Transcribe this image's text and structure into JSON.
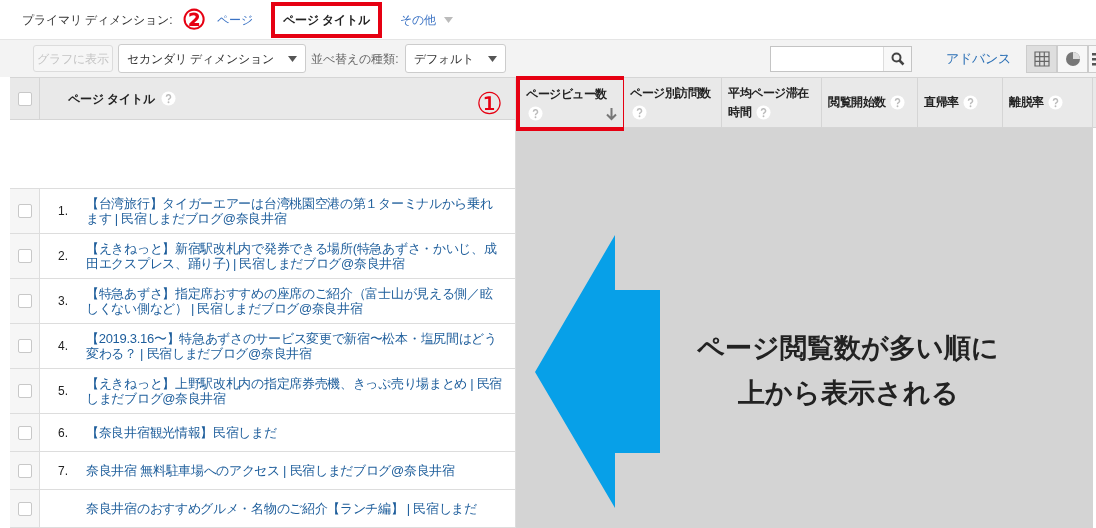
{
  "primary_dimension": {
    "label": "プライマリ ディメンション:",
    "options": [
      {
        "label": "ページ",
        "kind": "link",
        "selected": false,
        "highlighted": false
      },
      {
        "label": "ページ タイトル",
        "kind": "link",
        "selected": true,
        "highlighted": true
      },
      {
        "label": "その他",
        "kind": "menu",
        "selected": false,
        "highlighted": false
      }
    ]
  },
  "toolbar": {
    "chart_button": {
      "label": "グラフに表示",
      "disabled": true
    },
    "secondary_dimension": "セカンダリ ディメンション",
    "sort_label": "並べ替えの種類:",
    "sort_value": "デフォルト",
    "advanced_link": "アドバンス",
    "views": [
      {
        "kind": "table",
        "selected": true
      },
      {
        "kind": "pie",
        "selected": false
      },
      {
        "kind": "list",
        "selected": false
      }
    ]
  },
  "table": {
    "header_checkbox": {
      "checked": false
    },
    "columns": [
      {
        "label": "ページ タイトル",
        "sorted": false,
        "highlighted": false
      },
      {
        "label": "ページビュー数",
        "sorted": true,
        "highlighted": true
      },
      {
        "label": "ページ別訪問数",
        "sorted": false,
        "highlighted": false
      },
      {
        "label": "平均ページ滞在時間",
        "sorted": false,
        "highlighted": false
      },
      {
        "label": "閲覧開始数",
        "sorted": false,
        "highlighted": false
      },
      {
        "label": "直帰率",
        "sorted": false,
        "highlighted": false
      },
      {
        "label": "離脱率",
        "sorted": false,
        "highlighted": false
      }
    ],
    "rows": [
      {
        "number": "1.",
        "title": "【台湾旅行】タイガーエアーは台湾桃園空港の第１ターミナルから乗れます | 民宿しまだブログ@奈良井宿",
        "checked": false
      },
      {
        "number": "2.",
        "title": "【えきねっと】新宿駅改札内で発券できる場所(特急あずさ・かいじ、成田エクスプレス、踊り子) | 民宿しまだブログ@奈良井宿",
        "checked": false
      },
      {
        "number": "3.",
        "title": "【特急あずさ】指定席おすすめの座席のご紹介（富士山が見える側／眩しくない側など） | 民宿しまだブログ@奈良井宿",
        "checked": false
      },
      {
        "number": "4.",
        "title": "【2019.3.16〜】特急あずさのサービス変更で新宿〜松本・塩尻間はどう変わる？ | 民宿しまだブログ@奈良井宿",
        "checked": false
      },
      {
        "number": "5.",
        "title": "【えきねっと】上野駅改札内の指定席券売機、きっぷ売り場まとめ | 民宿しまだブログ@奈良井宿",
        "checked": false
      },
      {
        "number": "6.",
        "title": "【奈良井宿観光情報】民宿しまだ",
        "checked": false
      },
      {
        "number": "7.",
        "title": "奈良井宿 無料駐車場へのアクセス | 民宿しまだブログ@奈良井宿",
        "checked": false
      },
      {
        "title": "奈良井宿のおすすめグルメ・名物のご紹介【ランチ編】 | 民宿しまだ",
        "checked": false
      }
    ]
  },
  "annotations": {
    "markers": [
      "②",
      "①"
    ],
    "callout": [
      "ページ閲覧数が多い順に",
      "上から表示される"
    ]
  }
}
